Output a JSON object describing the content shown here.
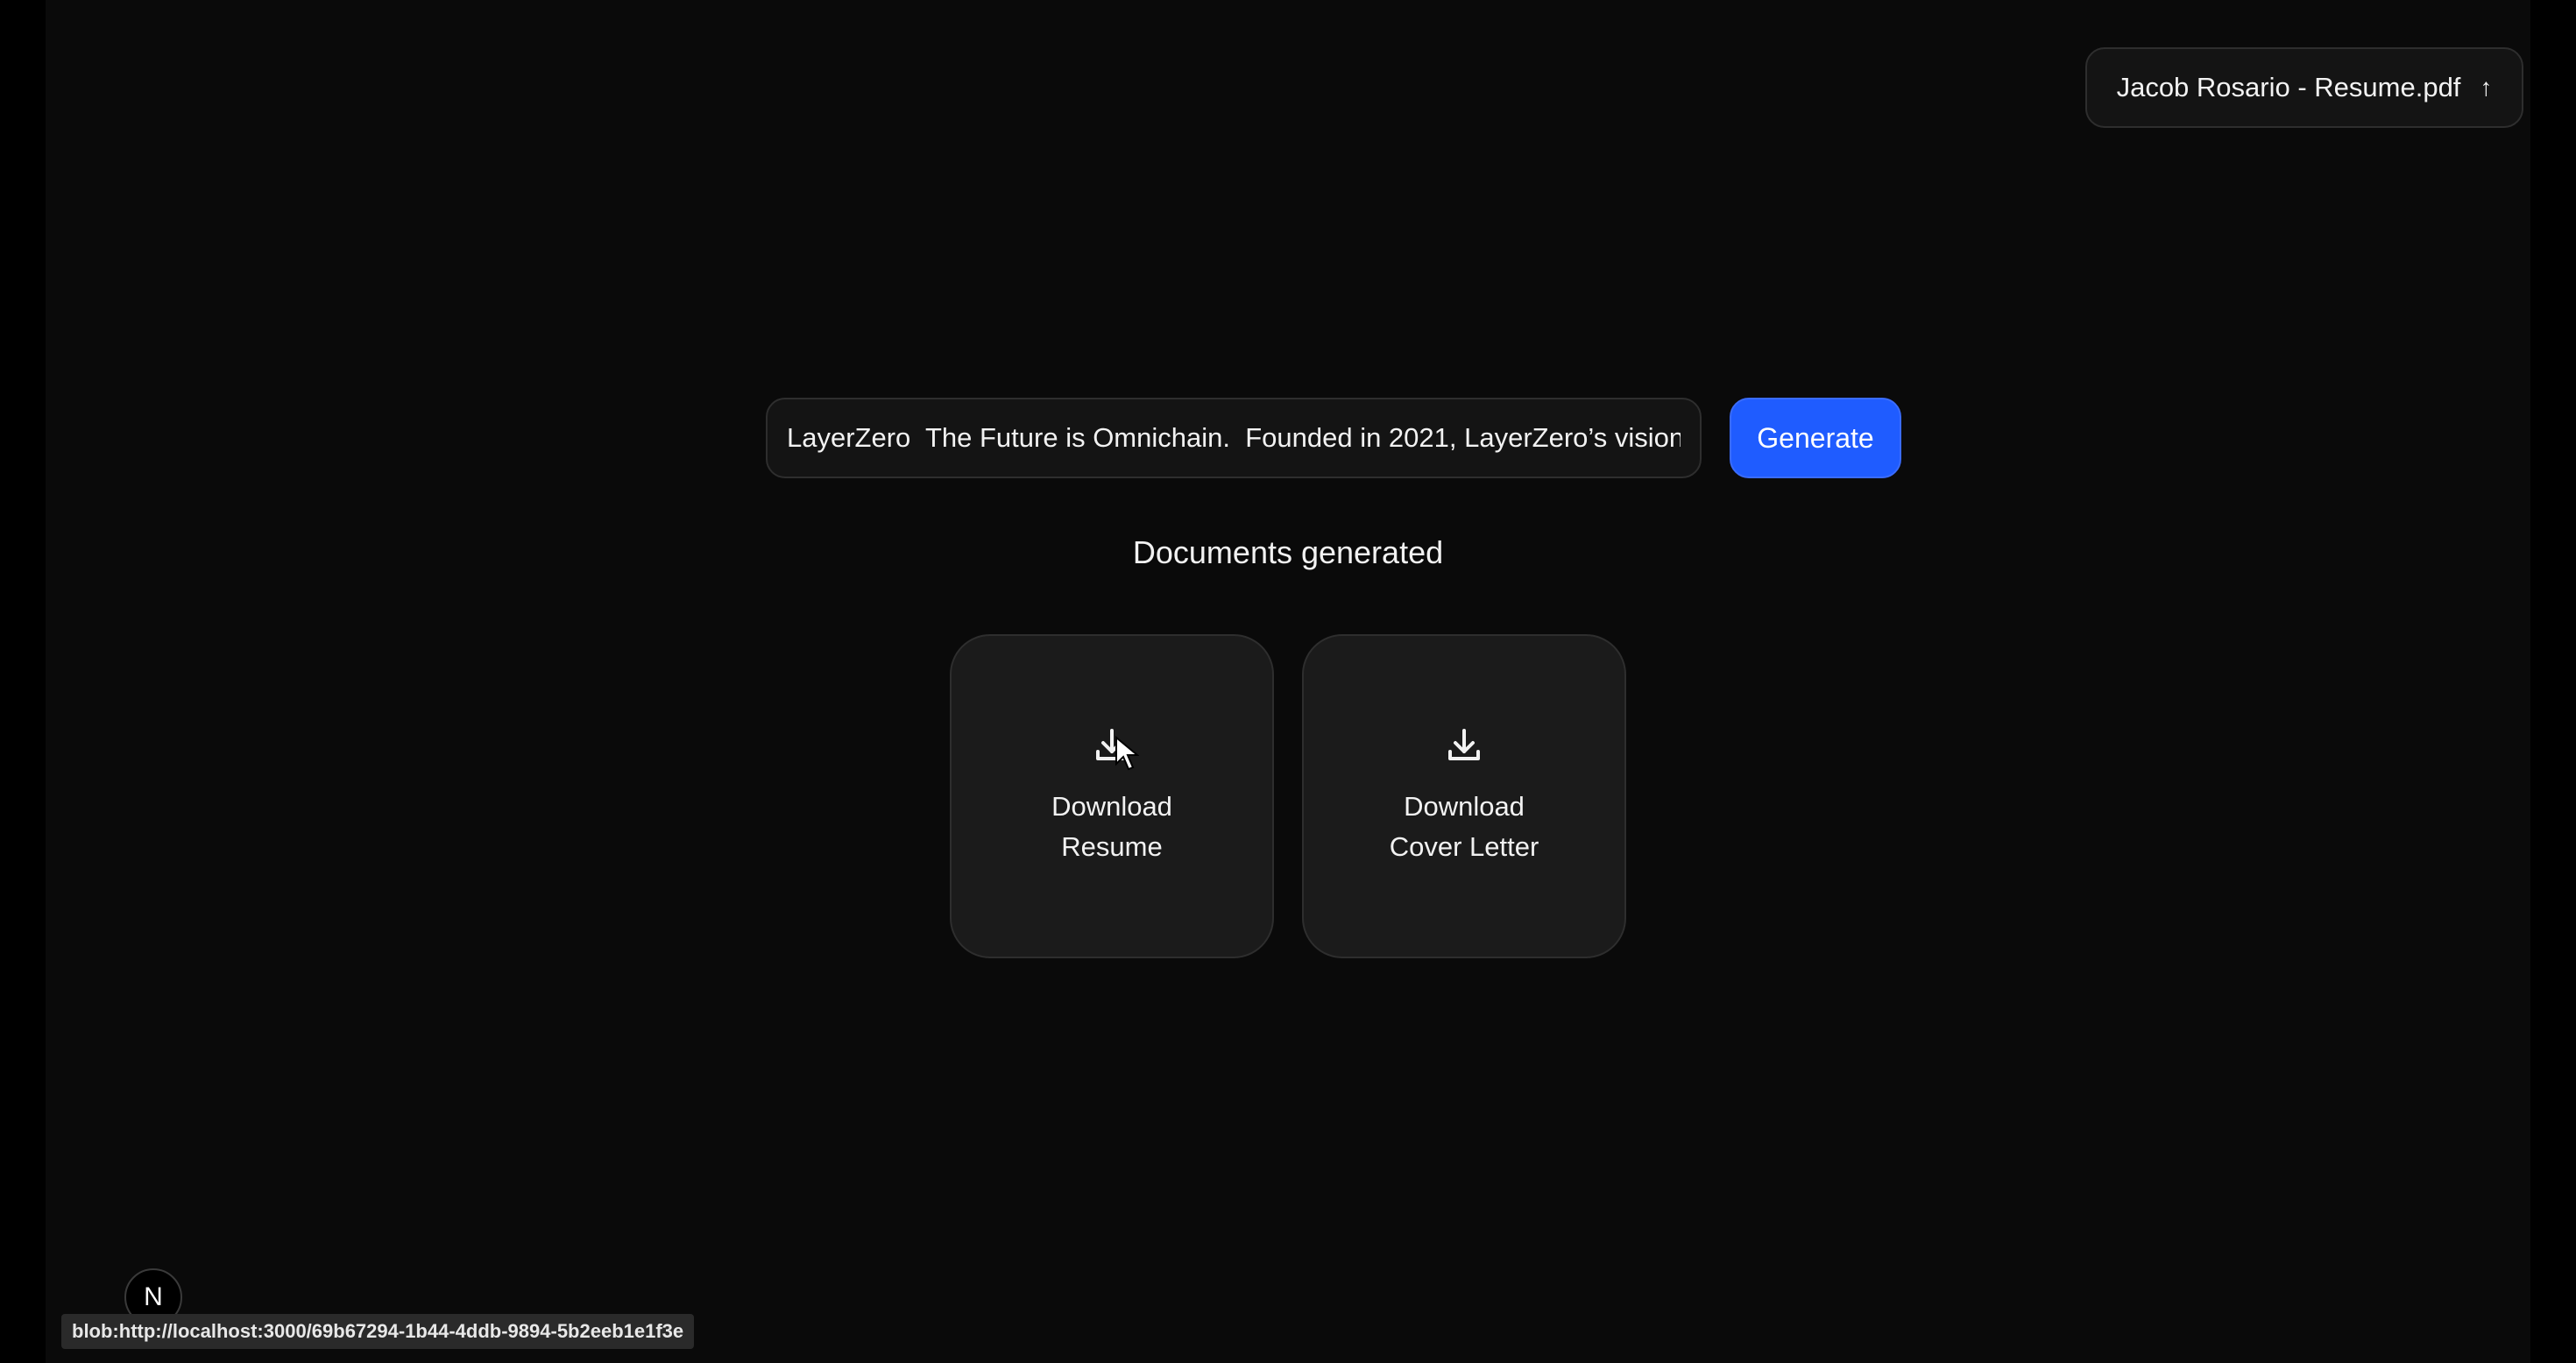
{
  "upload": {
    "filename": "Jacob Rosario - Resume.pdf",
    "arrow_glyph": "↑",
    "icon": "arrow-up-icon"
  },
  "prompt": {
    "value": "LayerZero  The Future is Omnichain.  Founded in 2021, LayerZero’s vision"
  },
  "generate": {
    "label": "Generate",
    "color": "#1f5cff"
  },
  "documents": {
    "heading": "Documents generated",
    "resume": {
      "line1": "Download",
      "line2": "Resume",
      "icon": "download-icon"
    },
    "cover_letter": {
      "line1": "Download",
      "line2": "Cover Letter",
      "icon": "download-icon"
    }
  },
  "dev_badge": {
    "letter": "N"
  },
  "status_bar": {
    "url": "blob:http://localhost:3000/69b67294-1b44-4ddb-9894-5b2eeb1e1f3e"
  }
}
